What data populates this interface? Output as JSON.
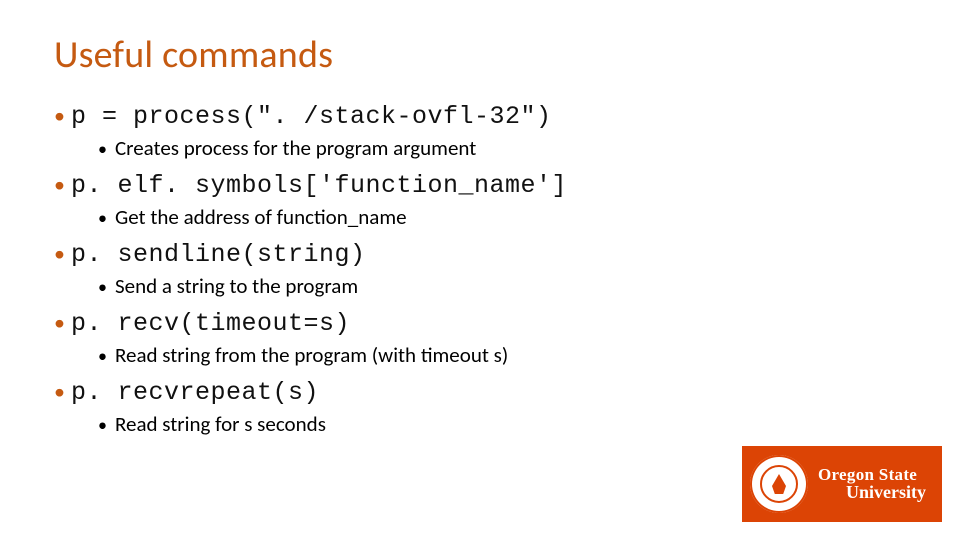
{
  "title": "Useful commands",
  "items": [
    {
      "code": "p = process(\". /stack-ovfl-32\")",
      "desc": "Creates process for the program argument"
    },
    {
      "code": "p. elf. symbols['function_name']",
      "desc": "Get the address of function_name"
    },
    {
      "code": "p. sendline(string)",
      "desc": "Send a string to the program"
    },
    {
      "code": "p. recv(timeout=s)",
      "desc": "Read string from the program (with timeout s)"
    },
    {
      "code": "p. recvrepeat(s)",
      "desc": "Read string for s seconds"
    }
  ],
  "logo": {
    "line1": "Oregon State",
    "line2": "University"
  }
}
